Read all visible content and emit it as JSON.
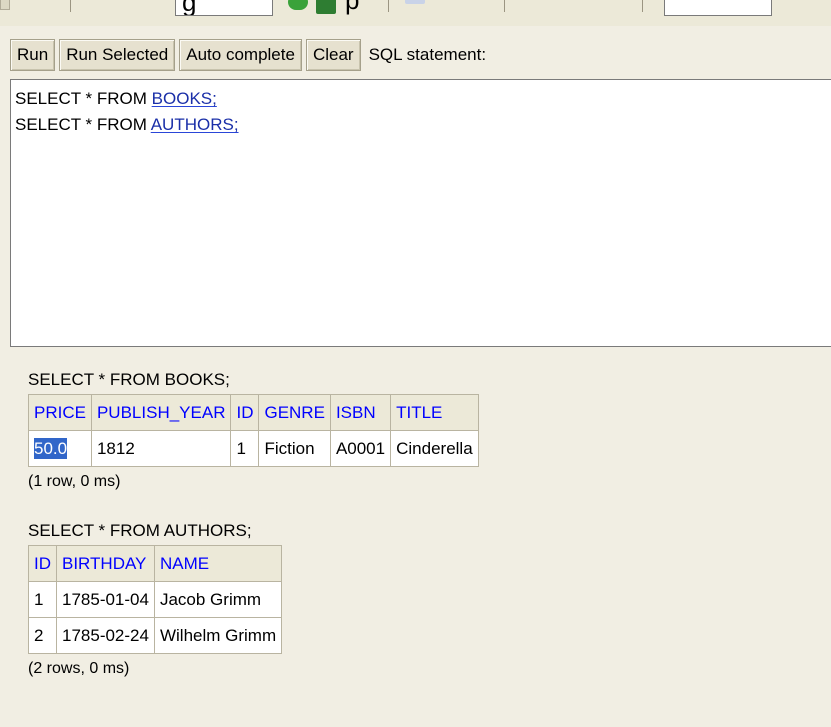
{
  "toolbar_fragment": {
    "cut_text": "g",
    "cut_text_2": "p"
  },
  "command_bar": {
    "run": "Run",
    "run_selected": "Run Selected",
    "auto_complete": "Auto complete",
    "clear": "Clear",
    "sql_label": "SQL statement:"
  },
  "editor": {
    "lines": [
      {
        "prefix": "SELECT * FROM ",
        "table": "BOOKS;"
      },
      {
        "prefix": "SELECT * FROM ",
        "table": "AUTHORS;"
      }
    ]
  },
  "results": [
    {
      "statement": "SELECT * FROM BOOKS;",
      "columns": [
        "PRICE",
        "PUBLISH_YEAR",
        "ID",
        "GENRE",
        "ISBN",
        "TITLE"
      ],
      "rows": [
        [
          "50.0",
          "1812",
          "1",
          "Fiction",
          "A0001",
          "Cinderella"
        ]
      ],
      "selected_cell": "50.0",
      "summary": "(1 row, 0 ms)"
    },
    {
      "statement": "SELECT * FROM AUTHORS;",
      "columns": [
        "ID",
        "BIRTHDAY",
        "NAME"
      ],
      "rows": [
        [
          "1",
          "1785-01-04",
          "Jacob Grimm"
        ],
        [
          "2",
          "1785-02-24",
          "Wilhelm Grimm"
        ]
      ],
      "summary": "(2 rows, 0 ms)"
    }
  ],
  "colors": {
    "background": "#f1eee3",
    "header_text": "#0000ff",
    "selection": "#3166c9",
    "table_link": "#1a2fa8"
  }
}
